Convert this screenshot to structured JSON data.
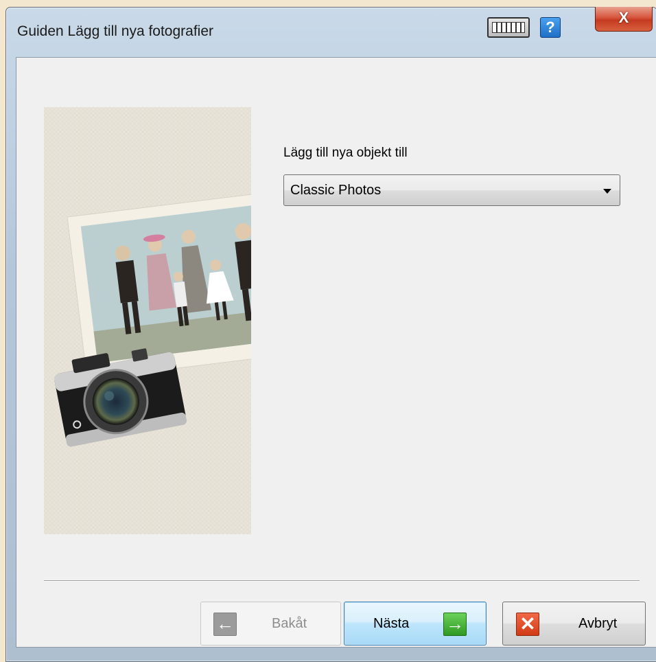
{
  "window": {
    "title": "Guiden Lägg till nya fotografier",
    "close_label": "X",
    "help_label": "?"
  },
  "icons": {
    "keyboard": "keyboard-icon",
    "help": "help-icon",
    "close": "close-icon",
    "back_arrow": "arrow-left-icon",
    "next_arrow": "arrow-right-icon",
    "cancel_x": "red-x-icon"
  },
  "main": {
    "instruction": "Lägg till nya objekt till",
    "collection_select": {
      "value": "Classic Photos"
    }
  },
  "buttons": {
    "back": {
      "label": "Bakåt",
      "enabled": false
    },
    "next": {
      "label": "Nästa",
      "enabled": true
    },
    "cancel": {
      "label": "Avbryt",
      "enabled": true
    }
  },
  "colors": {
    "next_accent": "#2f9a22",
    "cancel_accent": "#d23a16",
    "close_accent": "#c43a1f"
  }
}
